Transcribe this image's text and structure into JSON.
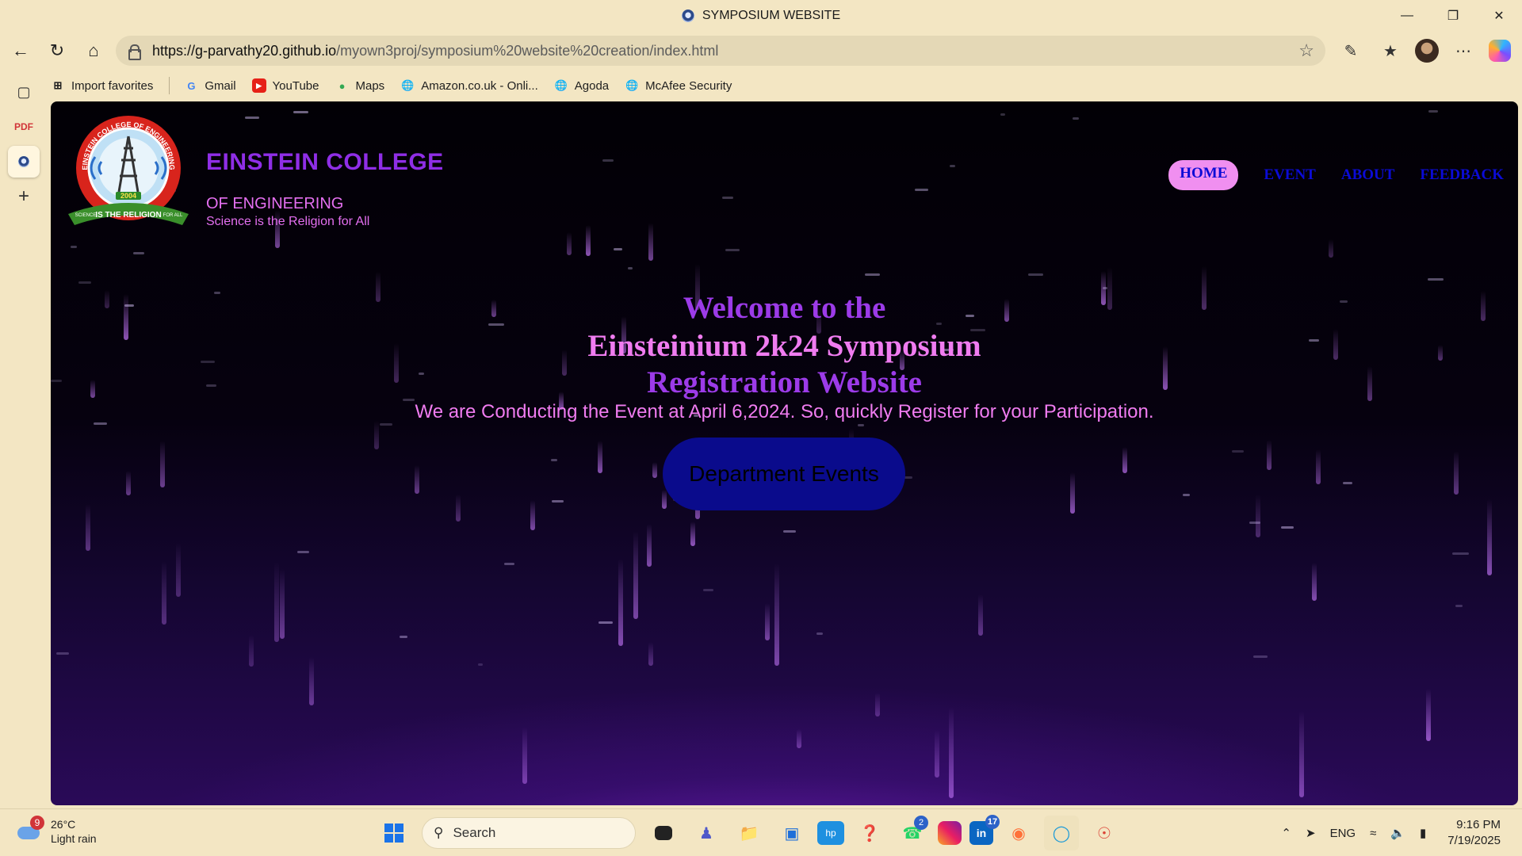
{
  "window": {
    "title": "SYMPOSIUM WEBSITE"
  },
  "address_bar": {
    "url_host": "https://g-parvathy20.github.io",
    "url_path": "/myown3proj/symposium%20website%20creation/index.html"
  },
  "favorites": [
    {
      "label": "Import favorites",
      "icon": "import-icon"
    },
    {
      "label": "Gmail",
      "icon": "google-icon"
    },
    {
      "label": "YouTube",
      "icon": "youtube-icon"
    },
    {
      "label": "Maps",
      "icon": "maps-icon"
    },
    {
      "label": "Amazon.co.uk - Onli...",
      "icon": "globe-icon"
    },
    {
      "label": "Agoda",
      "icon": "globe-icon"
    },
    {
      "label": "McAfee Security",
      "icon": "globe-icon"
    }
  ],
  "site": {
    "logo": {
      "text_top": "EINSTEIN COLLEGE OF ENGINEERING",
      "year": "2004",
      "ribbon": "IS THE RELIGION",
      "left": "SCIENCE",
      "right": "FOR ALL"
    },
    "college_name": "EINSTEIN COLLEGE",
    "college_suffix": "OF ENGINEERING",
    "tagline": "Science is the Religion for All",
    "nav": {
      "home": "HOME",
      "event": "EVENT",
      "about": "ABOUT",
      "feedback": "FEEDBACK"
    },
    "hero": {
      "line1": "Welcome to the",
      "line2": "Einsteinium 2k24 Symposium",
      "line3": "Registration Website",
      "subtitle": "We are Conducting the Event at April 6,2024. So, quickly Register for your Participation.",
      "button": "Department Events"
    }
  },
  "taskbar": {
    "weather": {
      "temp": "26°C",
      "condition": "Light rain",
      "badge": "9"
    },
    "search_label": "Search",
    "badges": {
      "whatsapp": "2",
      "linkedin": "17"
    },
    "language": "ENG",
    "time": "9:16 PM",
    "date": "7/19/2025"
  },
  "colors": {
    "accent_purple": "#9c3be8",
    "accent_pink": "#f07cf0",
    "nav_blue": "#0b0bd6",
    "button_navy": "#0a0b8c"
  }
}
